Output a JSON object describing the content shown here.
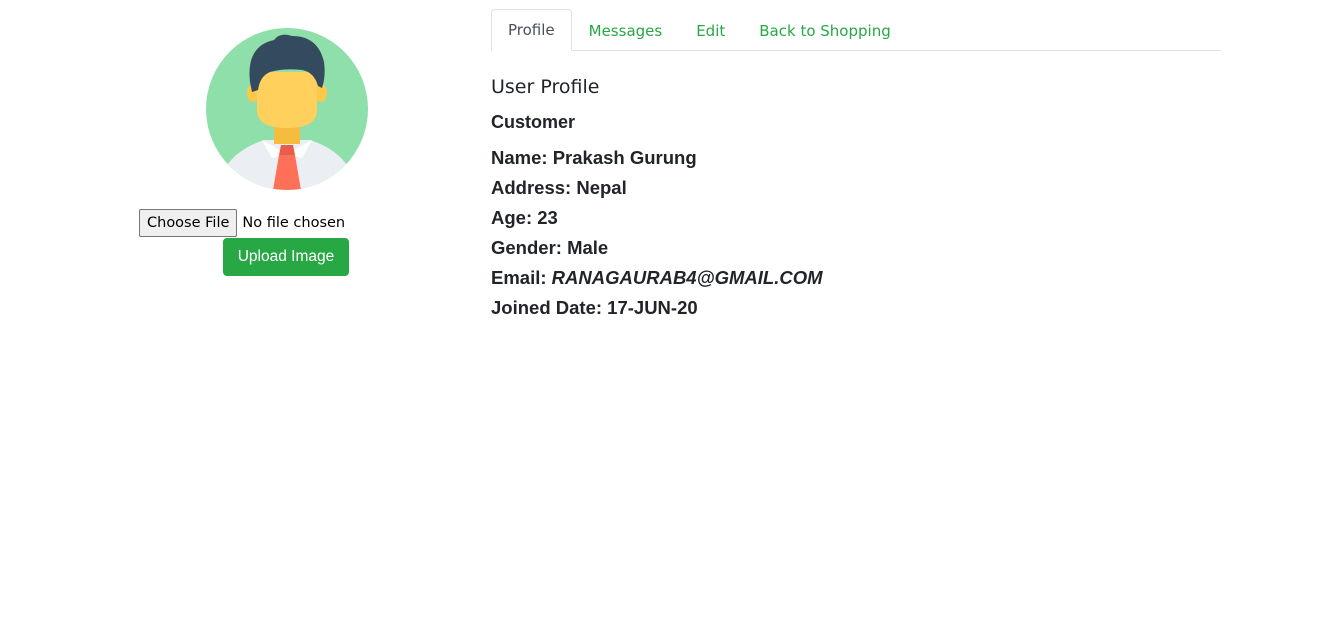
{
  "left": {
    "choose_file_label": "Choose File",
    "file_status": "No file chosen",
    "upload_label": "Upload Image",
    "avatar_icon": "user-avatar-icon"
  },
  "tabs": [
    {
      "label": "Profile",
      "active": true
    },
    {
      "label": "Messages",
      "active": false
    },
    {
      "label": "Edit",
      "active": false
    },
    {
      "label": "Back to Shopping",
      "active": false
    }
  ],
  "profile": {
    "section_title": "User Profile",
    "role": "Customer",
    "name_label": "Name:",
    "name_value": "Prakash Gurung",
    "address_label": "Address:",
    "address_value": "Nepal",
    "age_label": "Age:",
    "age_value": "23",
    "gender_label": "Gender:",
    "gender_value": "Male",
    "email_label": "Email:",
    "email_value": "RANAGAURAB4@GMAIL.COM",
    "joined_label": "Joined Date:",
    "joined_value": "17-JUN-20"
  },
  "colors": {
    "accent": "#28a745",
    "tab_active_text": "#495057",
    "text": "#212529",
    "avatar_bg": "#8fdfaa",
    "avatar_face": "#ffd15c",
    "avatar_hair": "#344a5e",
    "avatar_shirt": "#ebeef2",
    "avatar_tie": "#ff7058"
  }
}
